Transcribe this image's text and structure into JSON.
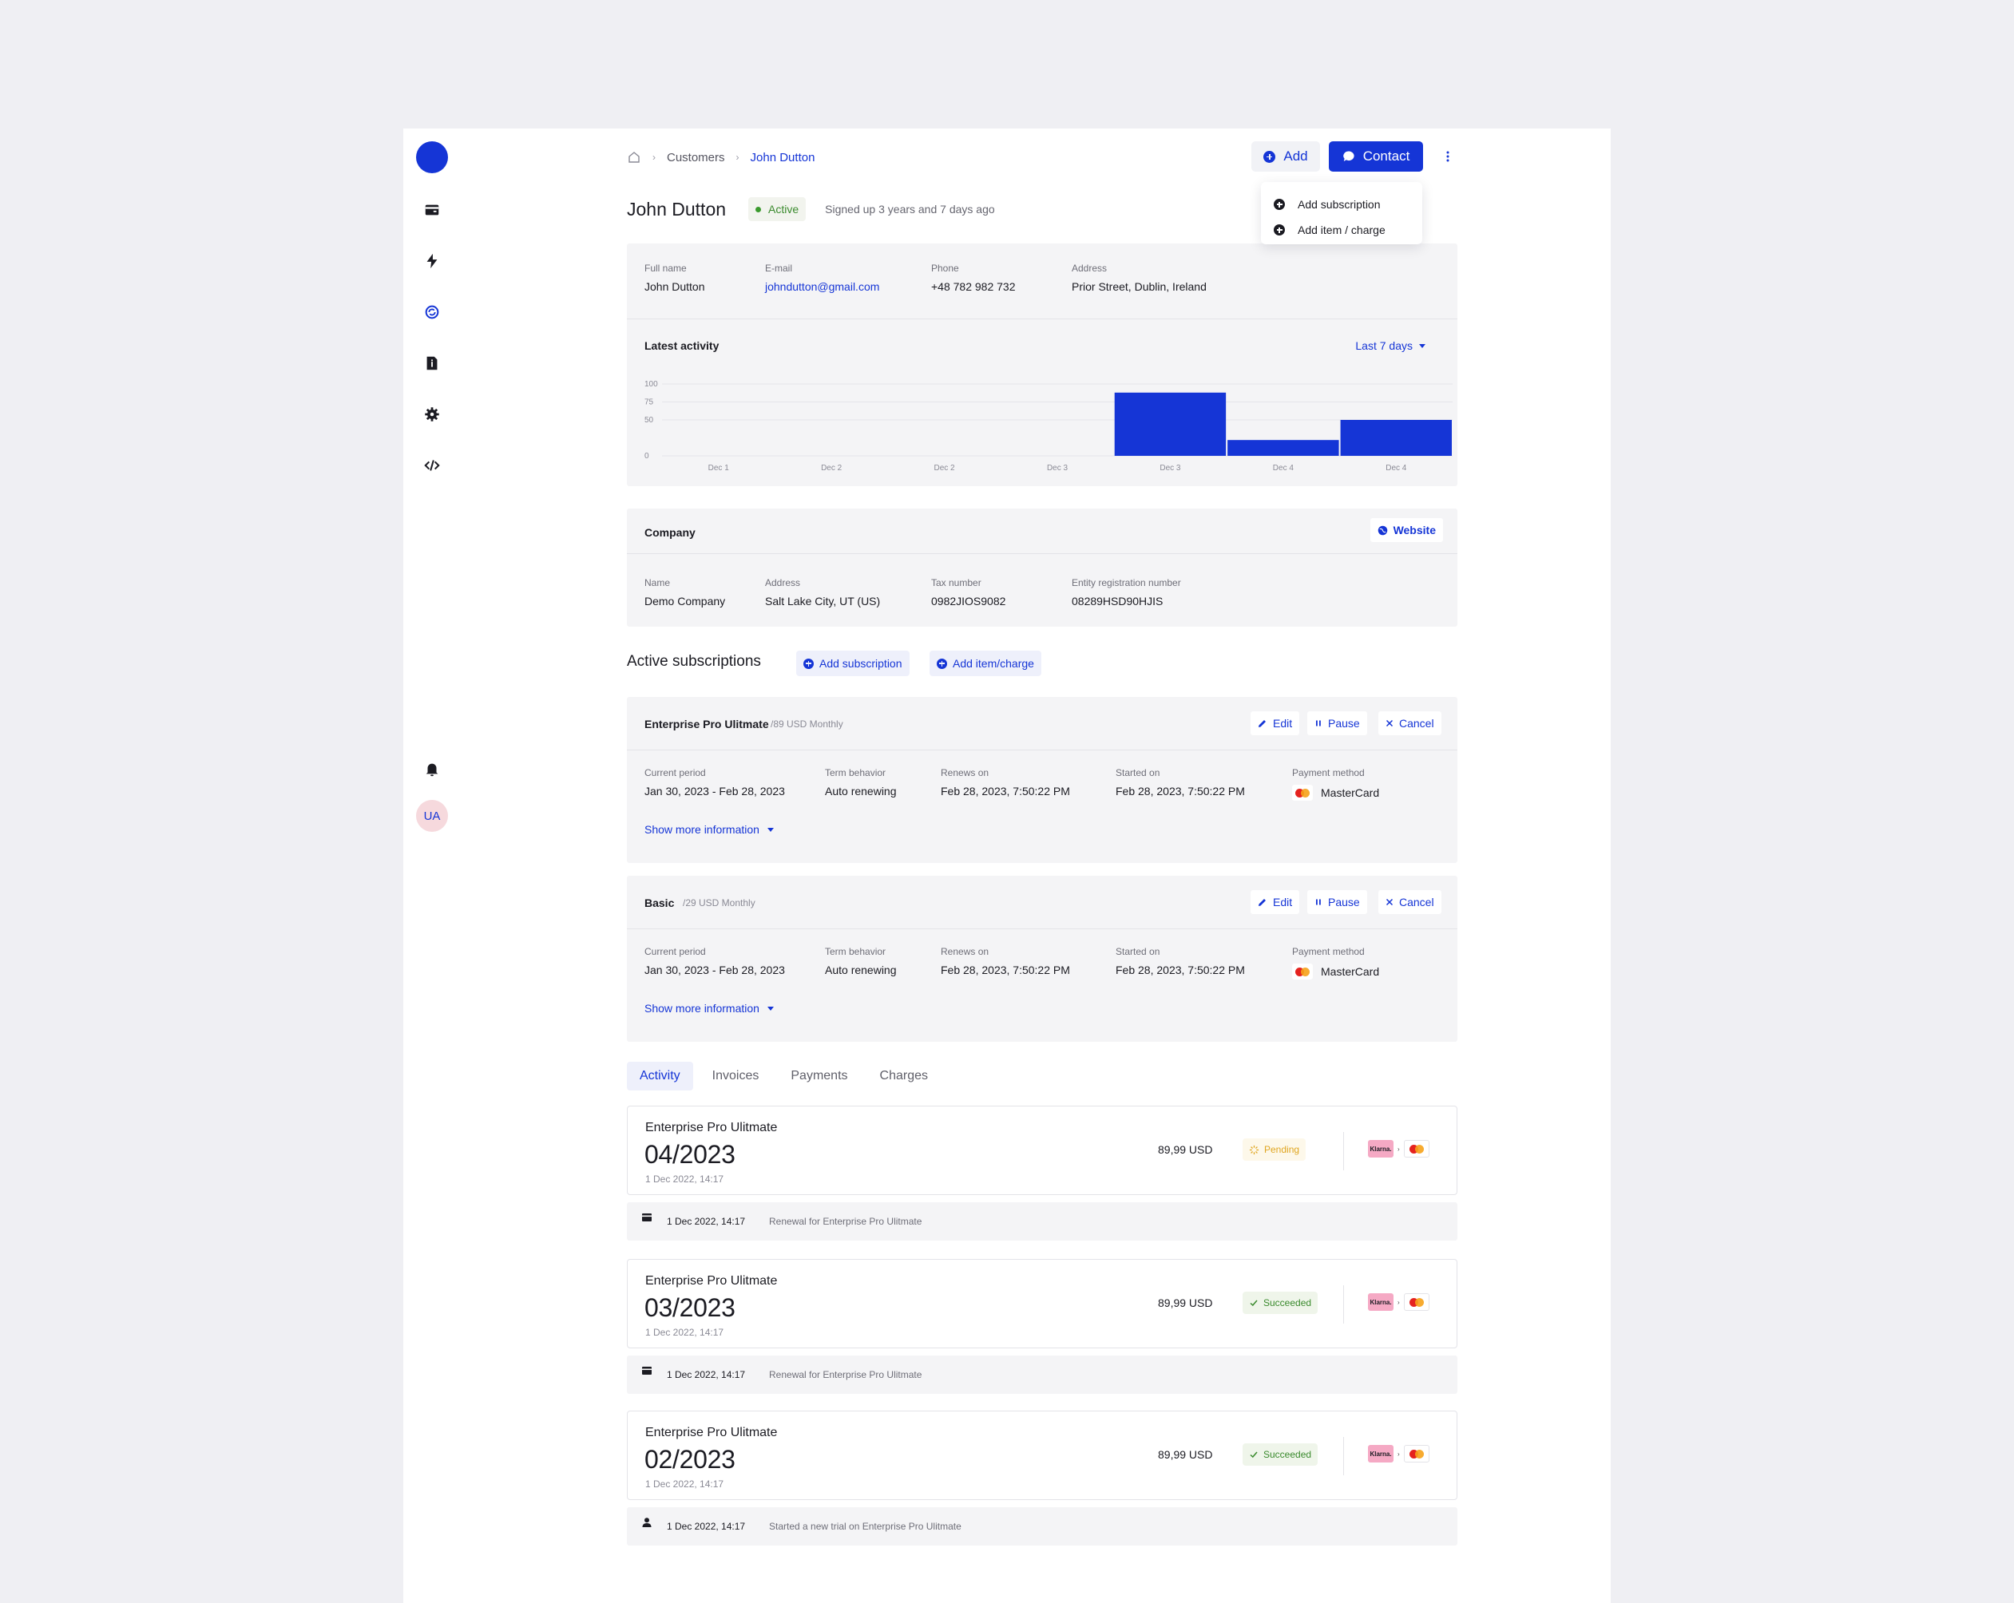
{
  "colors": {
    "accent": "#1535d6",
    "success": "#3a8a2d",
    "pending": "#e0a621"
  },
  "breadcrumb": {
    "home_icon": "home-icon",
    "items": [
      "Customers",
      "John Dutton"
    ]
  },
  "actions": {
    "add_label": "Add",
    "contact_label": "Contact",
    "menu": [
      "Add subscription",
      "Add item / charge"
    ]
  },
  "customer": {
    "name": "John Dutton",
    "status": "Active",
    "signed_up": "Signed up 3 years and 7 days ago",
    "fields": [
      {
        "label": "Full name",
        "value": "John Dutton"
      },
      {
        "label": "E-mail",
        "value": "johndutton@gmail.com"
      },
      {
        "label": "Phone",
        "value": "+48 782 982 732"
      },
      {
        "label": "Address",
        "value": "Prior Street, Dublin, Ireland"
      }
    ]
  },
  "activity": {
    "title": "Latest activity",
    "range": "Last 7 days"
  },
  "chart_data": {
    "type": "bar",
    "title": "Latest activity",
    "categories": [
      "Dec 1",
      "Dec 2",
      "Dec 2",
      "Dec 3",
      "Dec 3",
      "Dec 4",
      "Dec 4"
    ],
    "values": [
      0,
      0,
      0,
      0,
      88,
      22,
      50
    ],
    "ylim": [
      0,
      100
    ],
    "yticks": [
      0,
      50,
      75,
      100
    ],
    "grid": true,
    "color": "#1535d6"
  },
  "company": {
    "title": "Company",
    "website_label": "Website",
    "fields": [
      {
        "label": "Name",
        "value": "Demo Company"
      },
      {
        "label": "Address",
        "value": "Salt Lake City, UT (US)"
      },
      {
        "label": "Tax number",
        "value": "0982JIOS9082"
      },
      {
        "label": "Entity registration number",
        "value": "08289HSD90HJIS"
      }
    ]
  },
  "subscriptions": {
    "title": "Active subscriptions",
    "add_subscription": "Add subscription",
    "add_item": "Add item/charge",
    "edit_label": "Edit",
    "pause_label": "Pause",
    "cancel_label": "Cancel",
    "more_label": "Show more information",
    "labels": [
      "Current period",
      "Term behavior",
      "Renews on",
      "Started on",
      "Payment method"
    ],
    "items": [
      {
        "name": "Enterprise Pro Ulitmate",
        "price": "/89 USD Monthly",
        "period": "Jan 30, 2023 - Feb 28, 2023",
        "term": "Auto renewing",
        "renews": "Feb 28, 2023, 7:50:22 PM",
        "started": "Feb 28, 2023, 7:50:22 PM",
        "payment": "MasterCard"
      },
      {
        "name": "Basic",
        "price": "/29 USD Monthly",
        "period": "Jan 30, 2023 - Feb 28, 2023",
        "term": "Auto renewing",
        "renews": "Feb 28, 2023, 7:50:22 PM",
        "started": "Feb 28, 2023, 7:50:22 PM",
        "payment": "MasterCard"
      }
    ]
  },
  "tabs": [
    "Activity",
    "Invoices",
    "Payments",
    "Charges"
  ],
  "feed": [
    {
      "title": "Enterprise Pro Ulitmate",
      "period": "04/2023",
      "date": "1 Dec 2022, 14:17",
      "amount": "89,99 USD",
      "status": "Pending",
      "klarna": "Klarna.",
      "event_icon": "card-icon",
      "event_date": "1 Dec 2022, 14:17",
      "event_desc": "Renewal for Enterprise Pro Ulitmate"
    },
    {
      "title": "Enterprise Pro Ulitmate",
      "period": "03/2023",
      "date": "1 Dec 2022, 14:17",
      "amount": "89,99 USD",
      "status": "Succeeded",
      "klarna": "Klarna.",
      "event_icon": "card-icon",
      "event_date": "1 Dec 2022, 14:17",
      "event_desc": "Renewal for Enterprise Pro Ulitmate"
    },
    {
      "title": "Enterprise Pro Ulitmate",
      "period": "02/2023",
      "date": "1 Dec 2022, 14:17",
      "amount": "89,99 USD",
      "status": "Succeeded",
      "klarna": "Klarna.",
      "event_icon": "user-icon",
      "event_date": "1 Dec 2022, 14:17",
      "event_desc": "Started a new trial on Enterprise Pro Ulitmate"
    }
  ],
  "nav": {
    "avatar": "UA",
    "icons": [
      "wallet-icon",
      "bolt-icon",
      "subscriptions-icon",
      "document-icon",
      "gear-icon",
      "code-icon",
      "bell-icon"
    ]
  }
}
